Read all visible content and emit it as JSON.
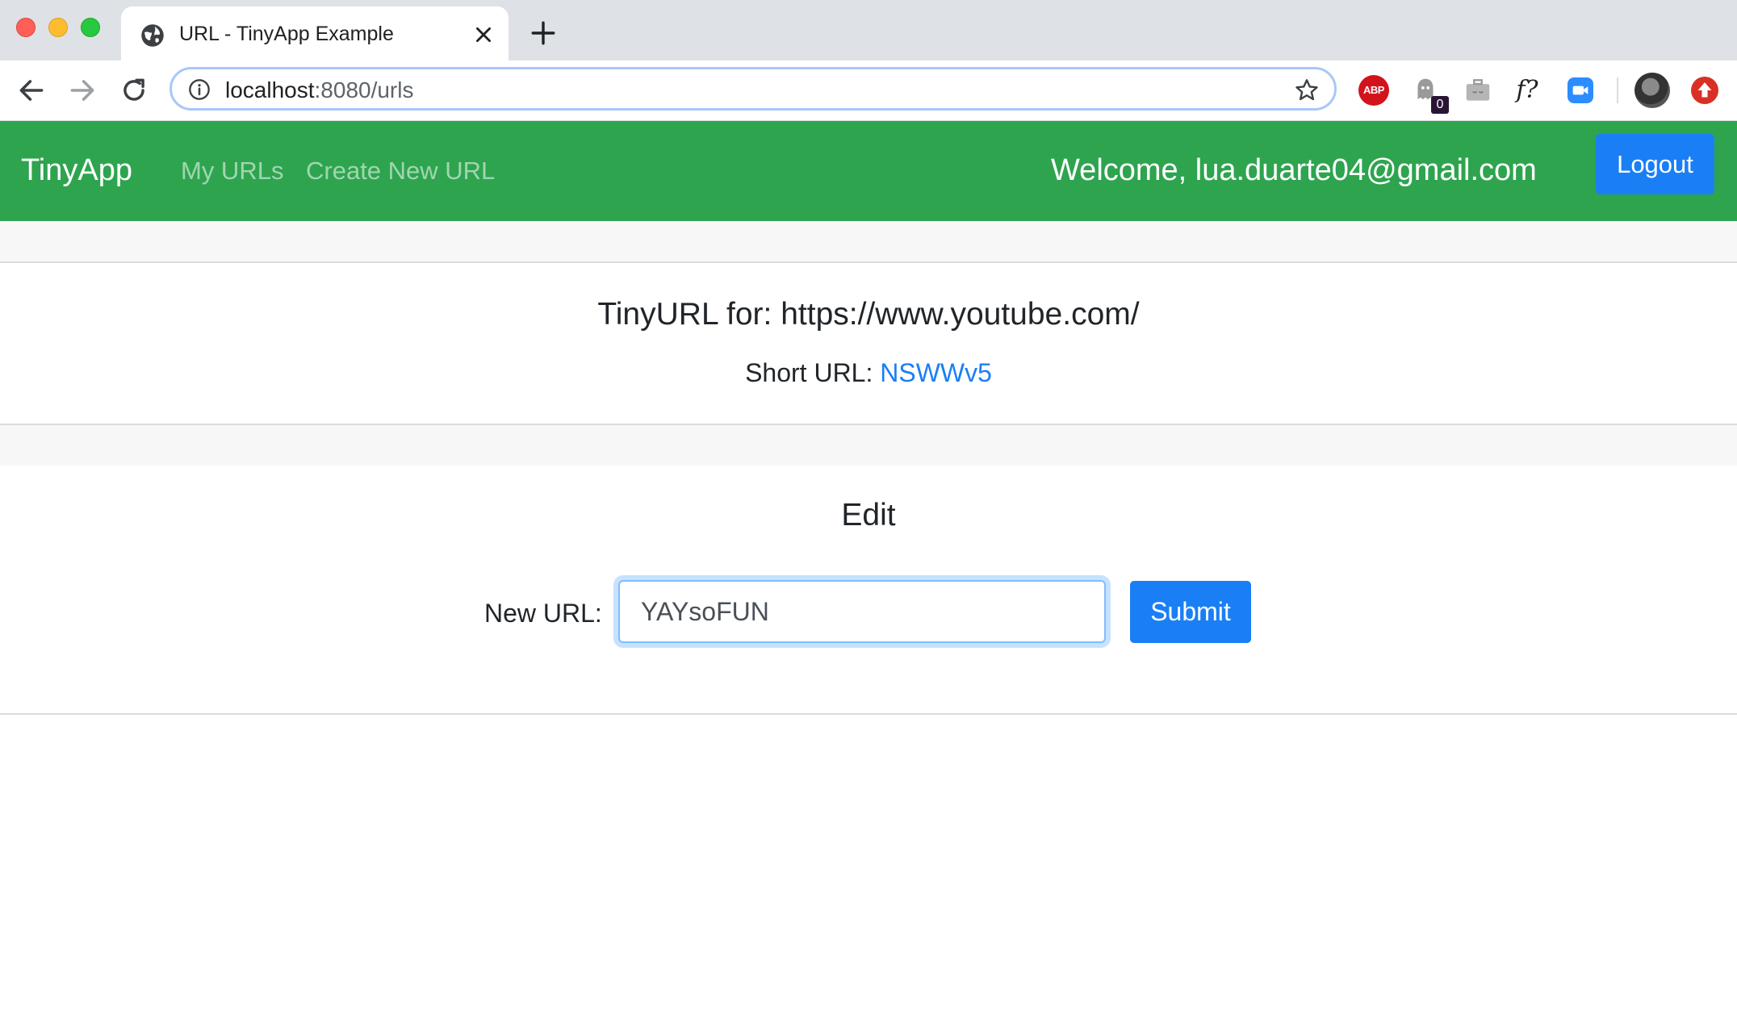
{
  "browser": {
    "tab_title": "URL - TinyApp Example",
    "address_host": "localhost",
    "address_path": ":8080/urls",
    "extensions": {
      "abp_label": "ABP",
      "ghostery_count": "0",
      "formula_label": "f?"
    }
  },
  "navbar": {
    "brand": "TinyApp",
    "links": [
      "My URLs",
      "Create New URL"
    ],
    "welcome": "Welcome, lua.duarte04@gmail.com",
    "logout_label": "Logout",
    "colors": {
      "background": "#2ea44f",
      "button": "#1a7ff5"
    }
  },
  "summary": {
    "title": "TinyURL for: https://www.youtube.com/",
    "short_url_label": "Short URL: ",
    "short_url_value": "NSWWv5"
  },
  "edit": {
    "title": "Edit",
    "new_url_label": "New URL:",
    "new_url_value": "YAYsoFUN",
    "submit_label": "Submit"
  }
}
